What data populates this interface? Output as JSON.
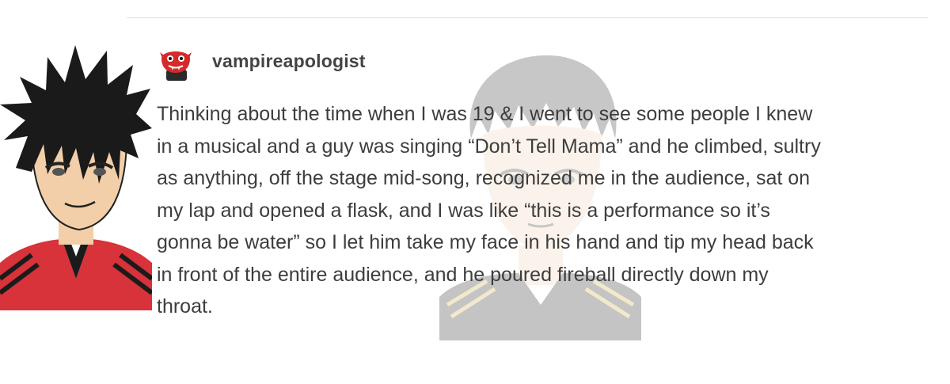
{
  "post": {
    "username": "vampireapologist",
    "body_lines": [
      "Thinking about the time when I was 19 & I went to see some people I knew",
      "in a musical and a guy was singing “Don’t Tell Mama” and he climbed, sultry",
      "as anything, off the stage mid-song, recognized me in the audience, sat on",
      "my lap and opened a flask, and I was like “this is a performance so it’s",
      "gonna be water” so I let him take my face in his hand and tip my head back",
      "in front of the entire audience, and he poured fireball directly down my",
      "throat."
    ]
  },
  "icons": {
    "avatar": "red-cartoon-vampire-avatar-icon",
    "left_character": "spiky-black-hair-anime-character",
    "watermark_character": "faded-anime-character-watermark"
  },
  "colors": {
    "text": "#3d3d3d",
    "username": "#444444",
    "divider": "#dcdcdc",
    "avatar_red": "#d42a2a"
  }
}
